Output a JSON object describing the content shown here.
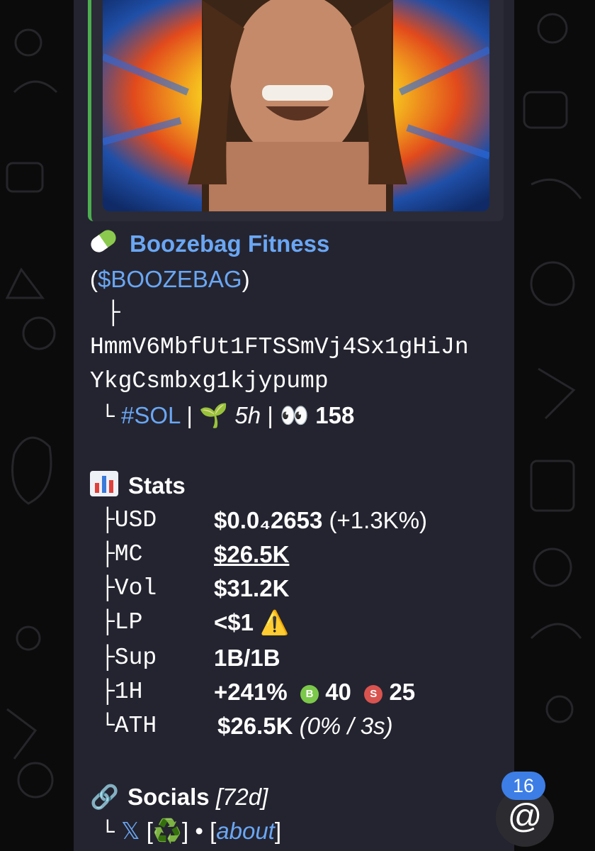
{
  "token": {
    "icon": "pill-icon",
    "name": "Boozebag Fitness",
    "ticker_open": "(",
    "ticker": "$BOOZEBAG",
    "ticker_close": ")",
    "tree_branch": "├",
    "address_line1": "HmmV6MbfUt1FTSSmVj4Sx1gHiJn",
    "address_line2": "YkgCsmbxg1kjypump",
    "meta": {
      "prefix": "└",
      "chain": "#SOL",
      "sep1": " | ",
      "age_icon": "seedling-icon",
      "age": "5h",
      "sep2": " | ",
      "views_icon": "eyes-icon",
      "views": "158"
    }
  },
  "stats": {
    "icon": "bar-chart-icon",
    "title": "Stats",
    "rows": [
      {
        "key": "├USD",
        "value": "$0.0₄2653",
        "extra": "(+1.3K%)"
      },
      {
        "key": "├MC",
        "value": "$26.5K",
        "extra": ""
      },
      {
        "key": "├Vol",
        "value": "$31.2K",
        "extra": ""
      },
      {
        "key": "├LP",
        "value": "<$1",
        "extra": "⚠️"
      },
      {
        "key": "├Sup",
        "value": "1B/1B",
        "extra": ""
      },
      {
        "key": "├1H",
        "value": "+241%",
        "buys_label": "B",
        "buys": "40",
        "sells_label": "S",
        "sells": "25"
      },
      {
        "key": "└ATH",
        "value": "$26.5K",
        "extra": "(0% / 3s)"
      }
    ]
  },
  "socials": {
    "icon": "link-icon",
    "title": "Socials",
    "age": "[72d]",
    "prefix": "└",
    "x_label": "𝕏",
    "bracket_open": "[",
    "recycle": "♻️",
    "bracket_close": "]",
    "dot": "•",
    "about_open": "[",
    "about": "about",
    "about_close": "]"
  },
  "mentions": {
    "count": "16",
    "symbol": "@"
  },
  "colors": {
    "background": "#0b0b0c",
    "bubble": "#242430",
    "link": "#6aa7f4",
    "accent_green": "#4cae4f",
    "badge": "#3d7ee6"
  }
}
